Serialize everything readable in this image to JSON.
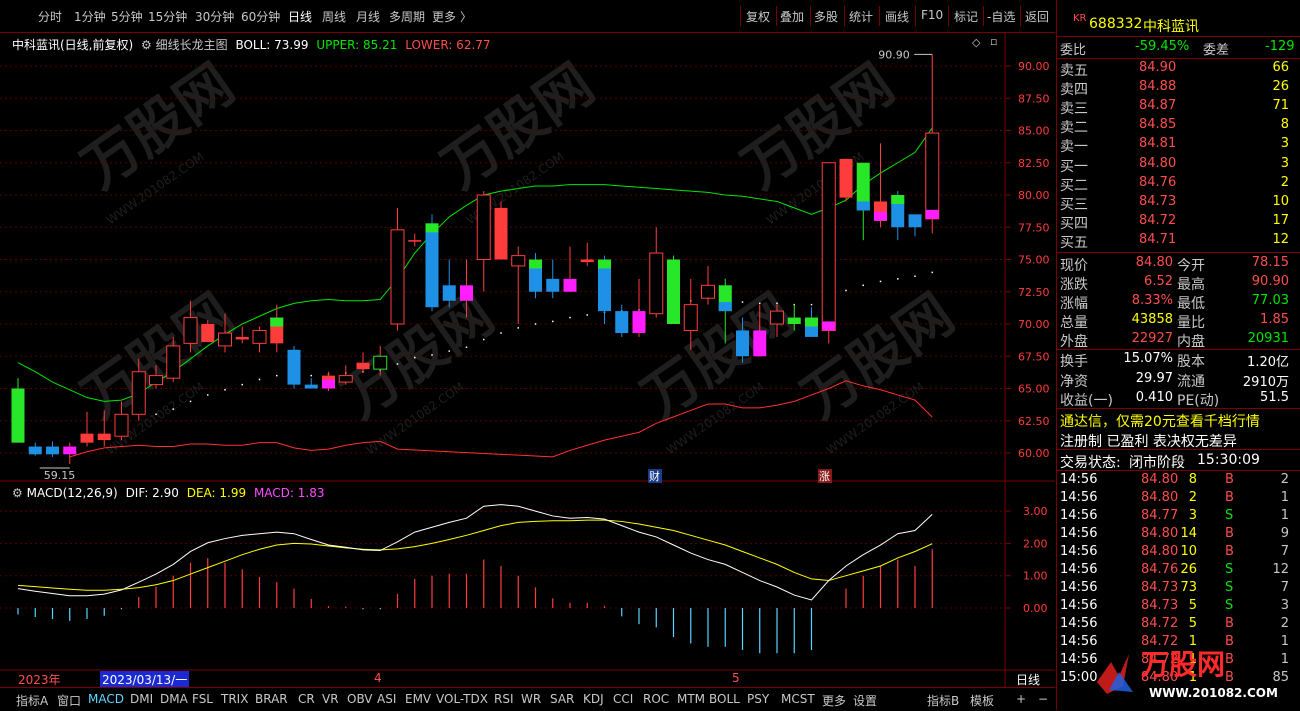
{
  "toolbar": {
    "periods": [
      "分时",
      "1分钟",
      "5分钟",
      "15分钟",
      "30分钟",
      "60分钟",
      "日线",
      "周线",
      "月线",
      "多周期",
      "更多"
    ],
    "active_period": "日线",
    "buttons": [
      "复权",
      "叠加",
      "多股",
      "统计",
      "画线",
      "F10",
      "标记",
      "-自选",
      "返回"
    ]
  },
  "main_info": {
    "name": "中科蓝讯(日线,前复权)",
    "indicator": "细线长龙主图",
    "boll": "BOLL: 73.99",
    "upper": "UPPER: 85.21",
    "lower": "LOWER: 62.77"
  },
  "price_axis": [
    "90.00",
    "87.50",
    "85.00",
    "82.50",
    "80.00",
    "77.50",
    "75.00",
    "72.50",
    "70.00",
    "67.50",
    "65.00",
    "62.50",
    "60.00"
  ],
  "annotations": {
    "high": "90.90",
    "low": "59.15",
    "badge_cai": "财",
    "badge_zhang": "涨"
  },
  "macd_info": {
    "name": "MACD(12,26,9)",
    "dif": "DIF: 2.90",
    "dea": "DEA: 1.99",
    "macd": "MACD: 1.83"
  },
  "macd_axis": [
    "3.00",
    "2.00",
    "1.00",
    "0.00"
  ],
  "date_axis": {
    "year": "2023年",
    "cursor": "2023/03/13/一",
    "m4": "4",
    "m5": "5",
    "period": "日线"
  },
  "bottom_tabs": [
    "指标A",
    "窗口",
    "MACD",
    "DMI",
    "DMA",
    "FSL",
    "TRIX",
    "BRAR",
    "CR",
    "VR",
    "OBV",
    "ASI",
    "EMV",
    "VOL-TDX",
    "RSI",
    "WR",
    "SAR",
    "KDJ",
    "CCI",
    "ROC",
    "MTM",
    "BOLL",
    "PSY",
    "MCST",
    "更多",
    "设置",
    "指标B",
    "模板"
  ],
  "quote": {
    "market": "KR",
    "code": "688332",
    "name": "中科蓝讯",
    "weibi_label": "委比",
    "weibi": "-59.45%",
    "weicha_label": "委差",
    "weicha": "-129",
    "asks": [
      {
        "label": "卖五",
        "price": "84.90",
        "vol": "66"
      },
      {
        "label": "卖四",
        "price": "84.88",
        "vol": "26"
      },
      {
        "label": "卖三",
        "price": "84.87",
        "vol": "71"
      },
      {
        "label": "卖二",
        "price": "84.85",
        "vol": "8"
      },
      {
        "label": "卖一",
        "price": "84.81",
        "vol": "3"
      }
    ],
    "bids": [
      {
        "label": "买一",
        "price": "84.80",
        "vol": "3"
      },
      {
        "label": "买二",
        "price": "84.76",
        "vol": "2"
      },
      {
        "label": "买三",
        "price": "84.73",
        "vol": "10"
      },
      {
        "label": "买四",
        "price": "84.72",
        "vol": "17"
      },
      {
        "label": "买五",
        "price": "84.71",
        "vol": "12"
      }
    ],
    "stats": [
      {
        "l1": "现价",
        "v1": "84.80",
        "c1": "red",
        "l2": "今开",
        "v2": "78.15",
        "c2": "red"
      },
      {
        "l1": "涨跌",
        "v1": "6.52",
        "c1": "red",
        "l2": "最高",
        "v2": "90.90",
        "c2": "red"
      },
      {
        "l1": "涨幅",
        "v1": "8.33%",
        "c1": "red",
        "l2": "最低",
        "v2": "77.03",
        "c2": "green"
      },
      {
        "l1": "总量",
        "v1": "43858",
        "c1": "yellow",
        "l2": "量比",
        "v2": "1.85",
        "c2": "red"
      },
      {
        "l1": "外盘",
        "v1": "22927",
        "c1": "red",
        "l2": "内盘",
        "v2": "20931",
        "c2": "green"
      }
    ],
    "stats2": [
      {
        "l1": "换手",
        "v1": "15.07%",
        "l2": "股本",
        "v2": "1.20亿"
      },
      {
        "l1": "净资",
        "v1": "29.97",
        "l2": "流通",
        "v2": "2910万"
      },
      {
        "l1": "收益(一)",
        "v1": "0.410",
        "l2": "PE(动)",
        "v2": "51.5"
      }
    ],
    "promo": "通达信，仅需20元查看千档行情",
    "tags": "注册制 已盈利 表决权无差异",
    "status_label": "交易状态:",
    "status": "闭市阶段",
    "status_time": "15:30:09"
  },
  "trades": [
    {
      "t": "14:56",
      "p": "84.80",
      "v": "8",
      "d": "B",
      "n": "2"
    },
    {
      "t": "14:56",
      "p": "84.80",
      "v": "2",
      "d": "B",
      "n": "1"
    },
    {
      "t": "14:56",
      "p": "84.77",
      "v": "3",
      "d": "S",
      "n": "1"
    },
    {
      "t": "14:56",
      "p": "84.80",
      "v": "14",
      "d": "B",
      "n": "9"
    },
    {
      "t": "14:56",
      "p": "84.80",
      "v": "10",
      "d": "B",
      "n": "7"
    },
    {
      "t": "14:56",
      "p": "84.76",
      "v": "26",
      "d": "S",
      "n": "12"
    },
    {
      "t": "14:56",
      "p": "84.73",
      "v": "73",
      "d": "S",
      "n": "7"
    },
    {
      "t": "14:56",
      "p": "84.73",
      "v": "5",
      "d": "S",
      "n": "3"
    },
    {
      "t": "14:56",
      "p": "84.72",
      "v": "5",
      "d": "B",
      "n": "2"
    },
    {
      "t": "14:56",
      "p": "84.72",
      "v": "1",
      "d": "B",
      "n": "1"
    },
    {
      "t": "14:56",
      "p": "84.72",
      "v": "1",
      "d": "B",
      "n": "1"
    },
    {
      "t": "15:00",
      "p": "84.80",
      "v": "1",
      "d": "B",
      "n": "85"
    }
  ],
  "watermark": {
    "brand": "万股网",
    "url": "WWW.201082.COM"
  },
  "colors": {
    "up": "#ff3c3c",
    "down": "#54b4ff",
    "mid": "#ffffff",
    "upper": "#00e600",
    "lower": "#ff3030",
    "dif": "#ffffff",
    "dea": "#ffff00",
    "grid": "#7a0000"
  },
  "chart_data": {
    "type": "candlestick",
    "ylim": [
      58.5,
      92.5
    ],
    "candles": [
      {
        "o": 65.0,
        "h": 65.8,
        "l": 60.8,
        "c": 60.8,
        "col": "g"
      },
      {
        "o": 60.5,
        "h": 60.8,
        "l": 59.8,
        "c": 59.9,
        "col": "b"
      },
      {
        "o": 60.5,
        "h": 60.9,
        "l": 59.7,
        "c": 59.9,
        "col": "b"
      },
      {
        "o": 59.9,
        "h": 60.8,
        "l": 59.15,
        "c": 60.5,
        "col": "m"
      },
      {
        "o": 60.8,
        "h": 63.2,
        "l": 60.5,
        "c": 61.5,
        "col": "r"
      },
      {
        "o": 61.0,
        "h": 63.3,
        "l": 60.5,
        "c": 61.5,
        "col": "r"
      },
      {
        "o": 61.3,
        "h": 64.0,
        "l": 61.0,
        "c": 63.0,
        "col": "h"
      },
      {
        "o": 63.0,
        "h": 67.3,
        "l": 62.5,
        "c": 66.3,
        "col": "h"
      },
      {
        "o": 65.3,
        "h": 66.8,
        "l": 65.0,
        "c": 66.0,
        "col": "h"
      },
      {
        "o": 65.8,
        "h": 69.0,
        "l": 65.5,
        "c": 68.3,
        "col": "h"
      },
      {
        "o": 68.5,
        "h": 71.8,
        "l": 67.8,
        "c": 70.5,
        "col": "h"
      },
      {
        "o": 70.0,
        "h": 70.3,
        "l": 68.6,
        "c": 68.6,
        "col": "r"
      },
      {
        "o": 68.3,
        "h": 70.8,
        "l": 67.8,
        "c": 69.3,
        "col": "h"
      },
      {
        "o": 69.0,
        "h": 69.8,
        "l": 68.5,
        "c": 68.8,
        "col": "r"
      },
      {
        "o": 68.5,
        "h": 69.8,
        "l": 67.8,
        "c": 69.5,
        "col": "h"
      },
      {
        "o": 68.5,
        "h": 71.5,
        "l": 67.8,
        "c": 70.5,
        "col": "r",
        "top": "g"
      },
      {
        "o": 68.0,
        "h": 68.3,
        "l": 65.0,
        "c": 65.3,
        "col": "b"
      },
      {
        "o": 65.3,
        "h": 65.8,
        "l": 65.0,
        "c": 65.0,
        "col": "b"
      },
      {
        "o": 65.0,
        "h": 66.3,
        "l": 64.8,
        "c": 66.0,
        "col": "r",
        "bot": "m"
      },
      {
        "o": 65.5,
        "h": 66.8,
        "l": 65.3,
        "c": 66.0,
        "col": "h"
      },
      {
        "o": 66.5,
        "h": 67.8,
        "l": 66.2,
        "c": 67.0,
        "col": "r"
      },
      {
        "o": 66.5,
        "h": 68.3,
        "l": 66.0,
        "c": 67.5,
        "col": "hg"
      },
      {
        "o": 70.0,
        "h": 79.0,
        "l": 69.5,
        "c": 77.3,
        "col": "h"
      },
      {
        "o": 76.5,
        "h": 77.0,
        "l": 76.0,
        "c": 76.5,
        "col": "r"
      },
      {
        "o": 77.8,
        "h": 78.5,
        "l": 71.0,
        "c": 71.3,
        "col": "b",
        "top": "g"
      },
      {
        "o": 73.0,
        "h": 75.0,
        "l": 71.3,
        "c": 71.8,
        "col": "b"
      },
      {
        "o": 73.0,
        "h": 75.0,
        "l": 70.5,
        "c": 71.8,
        "col": "m"
      },
      {
        "o": 75.0,
        "h": 80.3,
        "l": 72.5,
        "c": 80.0,
        "col": "h"
      },
      {
        "o": 79.0,
        "h": 79.5,
        "l": 75.0,
        "c": 75.0,
        "col": "r"
      },
      {
        "o": 75.3,
        "h": 76.0,
        "l": 70.0,
        "c": 74.5,
        "col": "h"
      },
      {
        "o": 75.0,
        "h": 75.5,
        "l": 72.0,
        "c": 72.5,
        "col": "b",
        "top": "g"
      },
      {
        "o": 73.5,
        "h": 75.0,
        "l": 72.0,
        "c": 72.5,
        "col": "b"
      },
      {
        "o": 73.5,
        "h": 76.0,
        "l": 72.5,
        "c": 72.5,
        "col": "m"
      },
      {
        "o": 75.0,
        "h": 76.3,
        "l": 74.5,
        "c": 74.8,
        "col": "r"
      },
      {
        "o": 75.0,
        "h": 75.3,
        "l": 70.0,
        "c": 71.0,
        "col": "b",
        "top": "g"
      },
      {
        "o": 71.0,
        "h": 71.5,
        "l": 69.0,
        "c": 69.3,
        "col": "b"
      },
      {
        "o": 71.0,
        "h": 73.5,
        "l": 69.0,
        "c": 69.3,
        "col": "m"
      },
      {
        "o": 75.5,
        "h": 77.5,
        "l": 70.5,
        "c": 70.8,
        "col": "h"
      },
      {
        "o": 75.0,
        "h": 75.3,
        "l": 70.0,
        "c": 70.0,
        "col": "g"
      },
      {
        "o": 71.5,
        "h": 73.5,
        "l": 68.0,
        "c": 69.5,
        "col": "h"
      },
      {
        "o": 73.0,
        "h": 74.5,
        "l": 71.5,
        "c": 72.0,
        "col": "h"
      },
      {
        "o": 73.0,
        "h": 73.5,
        "l": 68.5,
        "c": 71.0,
        "col": "g",
        "bot": "b"
      },
      {
        "o": 69.5,
        "h": 70.5,
        "l": 67.0,
        "c": 67.5,
        "col": "b"
      },
      {
        "o": 69.5,
        "h": 71.5,
        "l": 67.5,
        "c": 67.5,
        "col": "m"
      },
      {
        "o": 70.0,
        "h": 71.5,
        "l": 69.0,
        "c": 71.0,
        "col": "h"
      },
      {
        "o": 70.0,
        "h": 71.5,
        "l": 69.5,
        "c": 70.5,
        "col": "g"
      },
      {
        "o": 70.5,
        "h": 71.3,
        "l": 69.0,
        "c": 69.0,
        "col": "b",
        "top": "g"
      },
      {
        "o": 69.5,
        "h": 82.5,
        "l": 68.5,
        "c": 82.5,
        "col": "h",
        "bot": "m"
      },
      {
        "o": 82.8,
        "h": 82.8,
        "l": 79.5,
        "c": 79.8,
        "col": "r"
      },
      {
        "o": 82.5,
        "h": 82.5,
        "l": 76.5,
        "c": 78.8,
        "col": "g",
        "bot": "b"
      },
      {
        "o": 79.5,
        "h": 84.0,
        "l": 77.5,
        "c": 78.0,
        "col": "r",
        "bot": "m"
      },
      {
        "o": 80.0,
        "h": 80.3,
        "l": 76.5,
        "c": 77.5,
        "col": "b",
        "top": "g"
      },
      {
        "o": 78.5,
        "h": 78.5,
        "l": 76.8,
        "c": 77.5,
        "col": "b"
      },
      {
        "o": 78.15,
        "h": 90.9,
        "l": 77.03,
        "c": 84.8,
        "col": "h",
        "bot": "m"
      }
    ],
    "mid": [
      63.0,
      62.8,
      62.5,
      62.3,
      62.2,
      62.2,
      62.3,
      62.6,
      63.0,
      63.4,
      64.0,
      64.5,
      64.9,
      65.3,
      65.7,
      66.0,
      66.0,
      66.0,
      66.1,
      66.2,
      66.3,
      66.4,
      66.9,
      67.4,
      67.6,
      67.9,
      68.2,
      68.8,
      69.3,
      69.7,
      70.0,
      70.2,
      70.5,
      70.7,
      70.9,
      71.0,
      71.1,
      71.4,
      71.6,
      71.8,
      72.0,
      71.9,
      71.7,
      71.6,
      71.6,
      71.5,
      71.5,
      72.0,
      72.6,
      73.0,
      73.3,
      73.5,
      73.7,
      74.0
    ],
    "upper": [
      67.0,
      66.3,
      65.5,
      64.9,
      64.3,
      64.0,
      64.1,
      64.6,
      65.5,
      66.3,
      67.3,
      68.3,
      69.2,
      70.0,
      70.6,
      71.2,
      71.6,
      71.8,
      71.9,
      71.8,
      71.8,
      71.9,
      73.5,
      75.5,
      77.0,
      78.3,
      79.2,
      80.0,
      80.3,
      80.5,
      80.7,
      80.7,
      80.8,
      80.8,
      80.8,
      80.7,
      80.6,
      80.5,
      80.4,
      80.3,
      80.2,
      80.0,
      79.9,
      79.7,
      79.5,
      79.0,
      78.5,
      79.0,
      79.6,
      80.8,
      81.7,
      82.5,
      83.3,
      85.21
    ],
    "lower": "computed as 2*mid-upper",
    "macd_ylim": [
      -4.2,
      3.8
    ],
    "dif": [
      0.6,
      0.52,
      0.45,
      0.38,
      0.38,
      0.43,
      0.56,
      0.8,
      1.05,
      1.35,
      1.75,
      2.02,
      2.15,
      2.25,
      2.3,
      2.35,
      2.3,
      2.12,
      1.95,
      1.88,
      1.8,
      1.78,
      2.05,
      2.35,
      2.5,
      2.65,
      2.78,
      3.15,
      3.2,
      3.15,
      3.0,
      2.85,
      2.78,
      2.8,
      2.75,
      2.55,
      2.35,
      2.2,
      1.95,
      1.7,
      1.5,
      1.35,
      1.1,
      0.85,
      0.65,
      0.4,
      0.25,
      0.85,
      1.3,
      1.65,
      1.95,
      2.3,
      2.4,
      2.9
    ],
    "dea": [
      0.7,
      0.66,
      0.62,
      0.58,
      0.55,
      0.55,
      0.58,
      0.63,
      0.72,
      0.85,
      1.05,
      1.25,
      1.45,
      1.65,
      1.82,
      1.95,
      2.0,
      1.98,
      1.92,
      1.86,
      1.82,
      1.8,
      1.83,
      1.9,
      2.0,
      2.12,
      2.25,
      2.4,
      2.55,
      2.65,
      2.68,
      2.7,
      2.7,
      2.72,
      2.72,
      2.68,
      2.6,
      2.5,
      2.4,
      2.25,
      2.1,
      1.95,
      1.75,
      1.55,
      1.35,
      1.1,
      0.9,
      0.85,
      1.0,
      1.15,
      1.3,
      1.55,
      1.75,
      1.99
    ]
  }
}
